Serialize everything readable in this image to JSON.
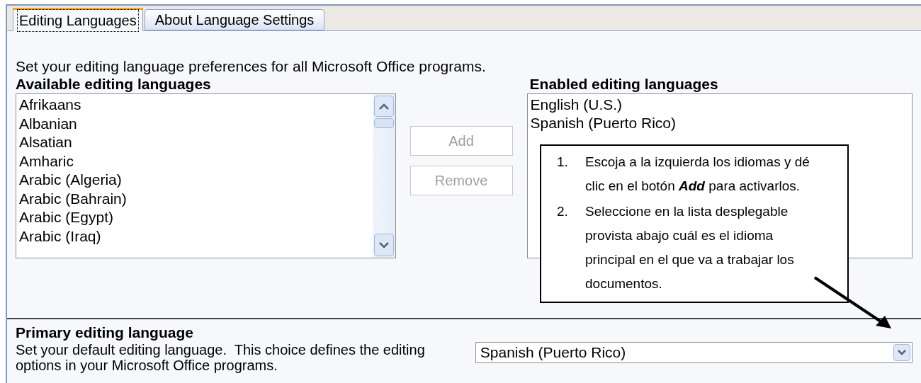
{
  "tabs": [
    {
      "label": "Editing Languages",
      "selected": true
    },
    {
      "label": "About Language Settings",
      "selected": false
    }
  ],
  "intro": "Set your editing language preferences for all Microsoft Office programs.",
  "available": {
    "heading": "Available editing languages",
    "items": [
      "Afrikaans",
      "Albanian",
      "Alsatian",
      "Amharic",
      "Arabic (Algeria)",
      "Arabic (Bahrain)",
      "Arabic (Egypt)",
      "Arabic (Iraq)"
    ]
  },
  "buttons": [
    {
      "label": "Add",
      "disabled": true
    },
    {
      "label": "Remove",
      "disabled": true
    }
  ],
  "enabled": {
    "heading": "Enabled editing languages",
    "items": [
      "English (U.S.)",
      "Spanish (Puerto Rico)"
    ]
  },
  "callout": {
    "steps": [
      {
        "number": "1.",
        "text": "Escoja a la izquierda los idiomas y dé clic en el botón **Add** para activarlos."
      },
      {
        "number": "2.",
        "text": "Seleccione en la lista desplegable provista abajo cuál es el idioma principal en el que va a trabajar los documentos."
      }
    ]
  },
  "primary": {
    "heading": "Primary editing language",
    "description": "Set your default editing language.  This choice defines the editing options in your Microsoft Office programs.",
    "value": "Spanish (Puerto Rico)"
  }
}
